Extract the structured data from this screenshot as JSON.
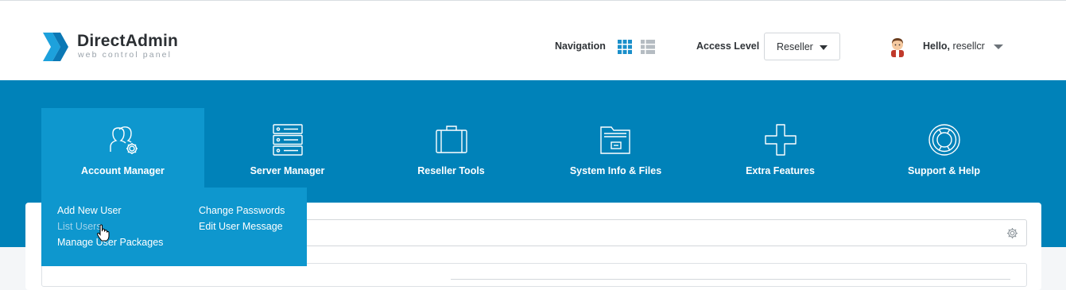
{
  "header": {
    "logo_title": "DirectAdmin",
    "logo_subtitle": "web control panel",
    "navigation_label": "Navigation",
    "navigation_views": [
      "grid-view-icon",
      "list-view-icon"
    ],
    "access_level_label": "Access Level",
    "access_level_value": "Reseller",
    "greeting": "Hello,",
    "username": "resellcr"
  },
  "menu": {
    "items": [
      {
        "label": "Account Manager",
        "icon": "account-manager-icon",
        "active": true
      },
      {
        "label": "Server Manager",
        "icon": "server-icon",
        "active": false
      },
      {
        "label": "Reseller Tools",
        "icon": "briefcase-icon",
        "active": false
      },
      {
        "label": "System Info & Files",
        "icon": "folder-icon",
        "active": false
      },
      {
        "label": "Extra Features",
        "icon": "plus-icon",
        "active": false
      },
      {
        "label": "Support & Help",
        "icon": "lifebuoy-icon",
        "active": false
      }
    ]
  },
  "dropdown": {
    "col1": [
      "Add New User",
      "List Users",
      "Manage User Packages"
    ],
    "col2": [
      "Change Passwords",
      "Edit User Message"
    ]
  },
  "colors": {
    "brand_blue": "#0082b9",
    "active_blue": "#0e97ce",
    "logo_blue": "#1da1dc"
  }
}
